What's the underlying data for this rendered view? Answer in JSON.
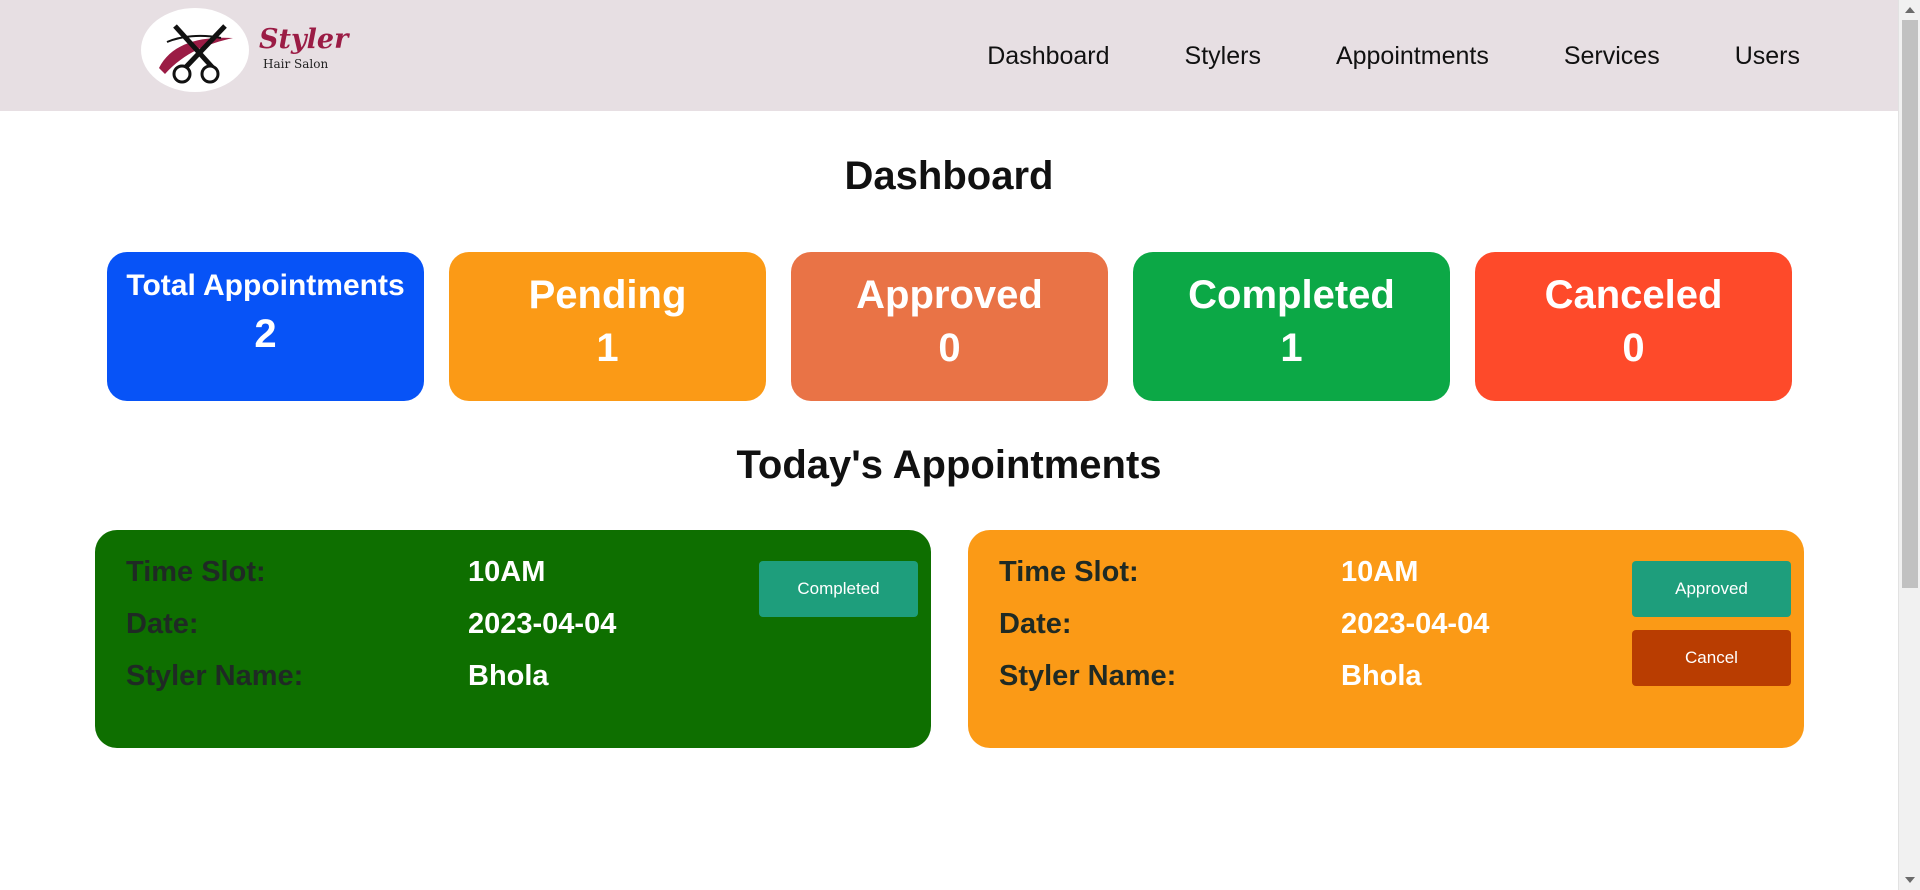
{
  "brand": {
    "name": "Styler",
    "subtitle": "Hair Salon"
  },
  "nav": {
    "items": [
      {
        "label": "Dashboard"
      },
      {
        "label": "Stylers"
      },
      {
        "label": "Appointments"
      },
      {
        "label": "Services"
      },
      {
        "label": "Users"
      }
    ]
  },
  "page": {
    "title": "Dashboard",
    "section_title": "Today's Appointments"
  },
  "stats": [
    {
      "label": "Total Appointments",
      "value": "2",
      "color": "#0753f7"
    },
    {
      "label": "Pending",
      "value": "1",
      "color": "#fb9a16"
    },
    {
      "label": "Approved",
      "value": "0",
      "color": "#e97346"
    },
    {
      "label": "Completed",
      "value": "1",
      "color": "#0ca846"
    },
    {
      "label": "Canceled",
      "value": "0",
      "color": "#fe4a2a"
    }
  ],
  "appointments": [
    {
      "color": "#0e6f00",
      "fields": {
        "time_slot_label": "Time Slot:",
        "time_slot": "10AM",
        "date_label": "Date:",
        "date": "2023-04-04",
        "styler_label": "Styler Name:",
        "styler": "Bhola"
      },
      "buttons": [
        {
          "label": "Completed",
          "color": "#1e9e7c"
        }
      ]
    },
    {
      "color": "#fb9a16",
      "fields": {
        "time_slot_label": "Time Slot:",
        "time_slot": "10AM",
        "date_label": "Date:",
        "date": "2023-04-04",
        "styler_label": "Styler Name:",
        "styler": "Bhola"
      },
      "buttons": [
        {
          "label": "Approved",
          "color": "#1e9e7c"
        },
        {
          "label": "Cancel",
          "color": "#b93d01"
        }
      ]
    }
  ]
}
